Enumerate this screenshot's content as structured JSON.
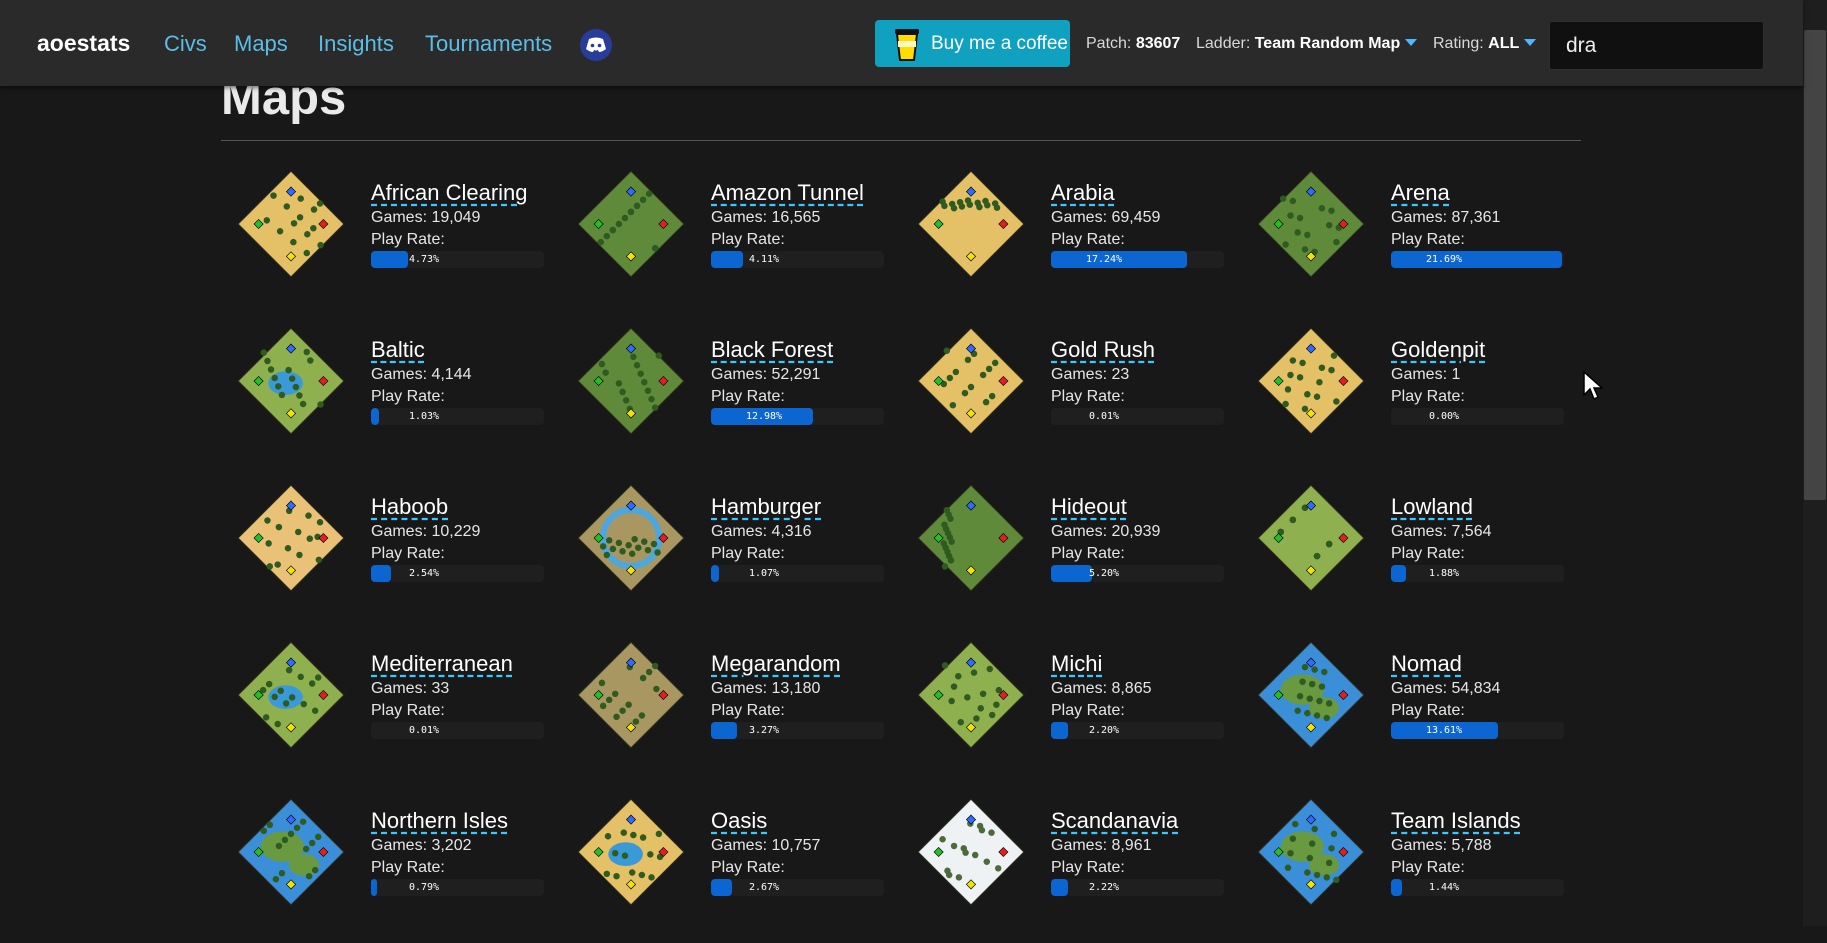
{
  "nav": {
    "brand": "aoestats",
    "links": [
      "Civs",
      "Maps",
      "Insights",
      "Tournaments"
    ],
    "coffee_label": "Buy me a coffee",
    "patch_label": "Patch:",
    "patch_value": "83607",
    "ladder_label": "Ladder:",
    "ladder_value": "Team Random Map",
    "rating_label": "Rating:",
    "rating_value": "ALL",
    "search_value": "dra"
  },
  "page": {
    "title": "Maps",
    "games_label": "Games:",
    "rate_label": "Play Rate:"
  },
  "colors": {
    "accent": "#5bbde6",
    "bar": "#0c66d2",
    "coffee": "#10a0c0"
  },
  "maps": [
    {
      "name": "African Clearing",
      "games": "19,049",
      "rate": 4.73,
      "rate_text": "4.73%",
      "terrain": "desert",
      "ring": "none"
    },
    {
      "name": "Amazon Tunnel",
      "games": "16,565",
      "rate": 4.11,
      "rate_text": "4.11%",
      "terrain": "forest",
      "ring": "none"
    },
    {
      "name": "Arabia",
      "games": "69,459",
      "rate": 17.24,
      "rate_text": "17.24%",
      "terrain": "desert",
      "ring": "none"
    },
    {
      "name": "Arena",
      "games": "87,361",
      "rate": 21.69,
      "rate_text": "21.69%",
      "terrain": "forest",
      "ring": "none"
    },
    {
      "name": "Baltic",
      "games": "4,144",
      "rate": 1.03,
      "rate_text": "1.03%",
      "terrain": "grass",
      "ring": "lake"
    },
    {
      "name": "Black Forest",
      "games": "52,291",
      "rate": 12.98,
      "rate_text": "12.98%",
      "terrain": "forest",
      "ring": "none"
    },
    {
      "name": "Gold Rush",
      "games": "23",
      "rate": 0.01,
      "rate_text": "0.01%",
      "terrain": "desert",
      "ring": "none"
    },
    {
      "name": "Goldenpit",
      "games": "1",
      "rate": 0.0,
      "rate_text": "0.00%",
      "terrain": "desert",
      "ring": "none"
    },
    {
      "name": "Haboob",
      "games": "10,229",
      "rate": 2.54,
      "rate_text": "2.54%",
      "terrain": "sand",
      "ring": "none"
    },
    {
      "name": "Hamburger",
      "games": "4,316",
      "rate": 1.07,
      "rate_text": "1.07%",
      "terrain": "mud",
      "ring": "river"
    },
    {
      "name": "Hideout",
      "games": "20,939",
      "rate": 5.2,
      "rate_text": "5.20%",
      "terrain": "forest",
      "ring": "none"
    },
    {
      "name": "Lowland",
      "games": "7,564",
      "rate": 1.88,
      "rate_text": "1.88%",
      "terrain": "grass",
      "ring": "none"
    },
    {
      "name": "Mediterranean",
      "games": "33",
      "rate": 0.01,
      "rate_text": "0.01%",
      "terrain": "grass",
      "ring": "lake"
    },
    {
      "name": "Megarandom",
      "games": "13,180",
      "rate": 3.27,
      "rate_text": "3.27%",
      "terrain": "mud",
      "ring": "none"
    },
    {
      "name": "Michi",
      "games": "8,865",
      "rate": 2.2,
      "rate_text": "2.20%",
      "terrain": "grass",
      "ring": "none"
    },
    {
      "name": "Nomad",
      "games": "54,834",
      "rate": 13.61,
      "rate_text": "13.61%",
      "terrain": "water",
      "ring": "none"
    },
    {
      "name": "Northern Isles",
      "games": "3,202",
      "rate": 0.79,
      "rate_text": "0.79%",
      "terrain": "water",
      "ring": "none"
    },
    {
      "name": "Oasis",
      "games": "10,757",
      "rate": 2.67,
      "rate_text": "2.67%",
      "terrain": "desert",
      "ring": "lake"
    },
    {
      "name": "Scandanavia",
      "games": "8,961",
      "rate": 2.22,
      "rate_text": "2.22%",
      "terrain": "snow",
      "ring": "none"
    },
    {
      "name": "Team Islands",
      "games": "5,788",
      "rate": 1.44,
      "rate_text": "1.44%",
      "terrain": "water",
      "ring": "none"
    }
  ]
}
